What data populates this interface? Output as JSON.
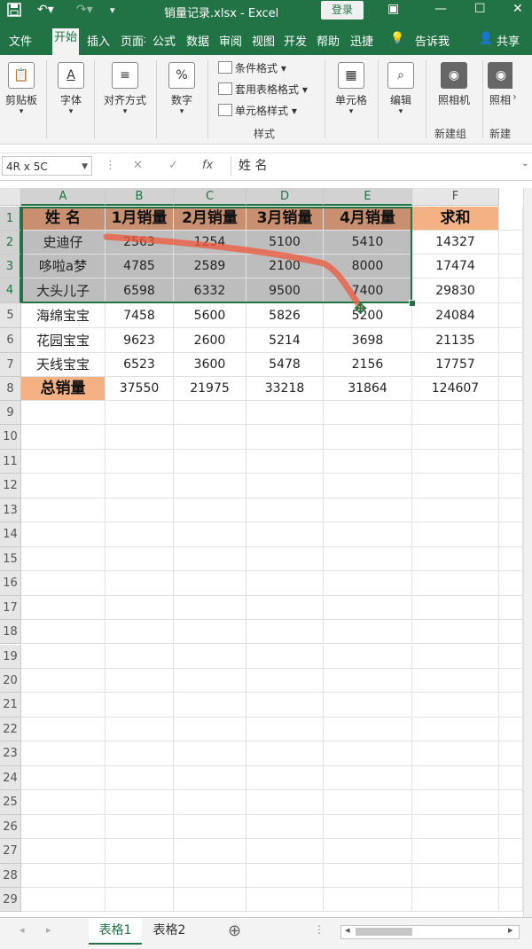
{
  "titlebar": {
    "title": "销量记录.xlsx  -  Excel",
    "login_label": "登录",
    "save_icon": "save-icon",
    "undo_icon": "undo-icon",
    "redo_icon": "redo-icon"
  },
  "tabs": [
    "文件",
    "开始",
    "插入",
    "页面布",
    "公式",
    "数据",
    "审阅",
    "视图",
    "开发",
    "帮助",
    "迅捷",
    "告诉我",
    "共享"
  ],
  "ribbon": {
    "clipboard": "剪贴板",
    "font": "字体",
    "align": "对齐方式",
    "number": "数字",
    "percent_glyph": "%",
    "cond_format": "条件格式",
    "table_format": "套用表格格式",
    "cell_style": "单元格样式",
    "styles_group": "样式",
    "cells": "单元格",
    "edit": "编辑",
    "camera": "照相机",
    "camera2": "照相",
    "new_group": "新建组",
    "new_group2": "新建"
  },
  "formula_bar": {
    "namebox": "4R x 5C",
    "fx": "fx",
    "value": "姓 名"
  },
  "columns": [
    "A",
    "B",
    "C",
    "D",
    "E",
    "F"
  ],
  "rows": [
    "1",
    "2",
    "3",
    "4",
    "5",
    "6",
    "7",
    "8",
    "9",
    "10",
    "11",
    "12",
    "13",
    "14",
    "15",
    "16",
    "17",
    "18",
    "19",
    "20",
    "21",
    "22",
    "23",
    "24",
    "25",
    "26",
    "27",
    "28",
    "29"
  ],
  "table": {
    "headers": [
      "姓 名",
      "1月销量",
      "2月销量",
      "3月销量",
      "4月销量",
      "求和"
    ],
    "rows": [
      [
        "史迪仔",
        "2563",
        "1254",
        "5100",
        "5410",
        "14327"
      ],
      [
        "哆啦a梦",
        "4785",
        "2589",
        "2100",
        "8000",
        "17474"
      ],
      [
        "大头儿子",
        "6598",
        "6332",
        "9500",
        "7400",
        "29830"
      ],
      [
        "海绵宝宝",
        "7458",
        "5600",
        "5826",
        "5200",
        "24084"
      ],
      [
        "花园宝宝",
        "9623",
        "2600",
        "5214",
        "3698",
        "21135"
      ],
      [
        "天线宝宝",
        "6523",
        "3600",
        "5478",
        "2156",
        "17757"
      ],
      [
        "总销量",
        "37550",
        "21975",
        "33218",
        "31864",
        "124607"
      ]
    ]
  },
  "sheets": [
    "表格1",
    "表格2"
  ],
  "colors": {
    "excel_green": "#217346",
    "header_orange": "#f4b183",
    "selection": "#bdbdbd"
  }
}
